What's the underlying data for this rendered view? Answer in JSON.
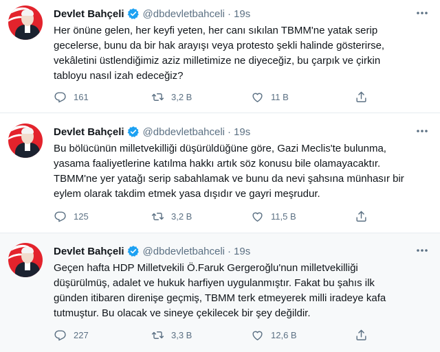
{
  "tweets": [
    {
      "name": "Devlet Bahçeli",
      "handle": "@dbdevletbahceli",
      "separator": "·",
      "time": "19s",
      "lines": [
        "Her önüne gelen, her keyfi yeten, her canı sıkılan TBMM'ne yatak serip",
        "gecelerse, bunu da bir hak arayışı veya protesto şekli halinde gösterirse,",
        "vekâletini üstlendiğimiz aziz milletimize ne diyeceğiz, bu çarpık ve çirkin",
        "tabloyu nasıl izah edeceğiz?"
      ],
      "replies": "161",
      "retweets": "3,2 B",
      "likes": "11 B"
    },
    {
      "name": "Devlet Bahçeli",
      "handle": "@dbdevletbahceli",
      "separator": "·",
      "time": "19s",
      "lines": [
        "Bu bölücünün milletvekilliği düşürüldüğüne göre, Gazi Meclis'te bulunma,",
        "yasama faaliyetlerine katılma hakkı artık söz konusu bile olamayacaktır.",
        "TBMM'ne yer yatağı serip sabahlamak ve bunu da nevi şahsına münhasır bir",
        "eylem olarak takdim etmek yasa dışıdır ve gayri meşrudur."
      ],
      "replies": "125",
      "retweets": "3,2 B",
      "likes": "11,5 B"
    },
    {
      "name": "Devlet Bahçeli",
      "handle": "@dbdevletbahceli",
      "separator": "·",
      "time": "19s",
      "lines": [
        "Geçen hafta HDP Milletvekili Ö.Faruk Gergeroğlu'nun milletvekilliği",
        "düşürülmüş, adalet ve hukuk harfiyen uygulanmıştır. Fakat bu şahıs ilk",
        "günden itibaren direnişe geçmiş, TBMM terk etmeyerek milli iradeye kafa",
        "tutmuştur. Bu olacak ve sineye çekilecek bir şey değildir."
      ],
      "replies": "227",
      "retweets": "3,3 B",
      "likes": "12,6 B"
    }
  ],
  "colors": {
    "verified": "#1da1f2",
    "secondary_text": "#5b7083",
    "avatar_bg": "#e3232c",
    "highlight_bg": "#f7f9fa"
  },
  "icons": [
    "verified-badge-icon",
    "more-icon",
    "reply-icon",
    "retweet-icon",
    "like-icon",
    "share-icon"
  ]
}
